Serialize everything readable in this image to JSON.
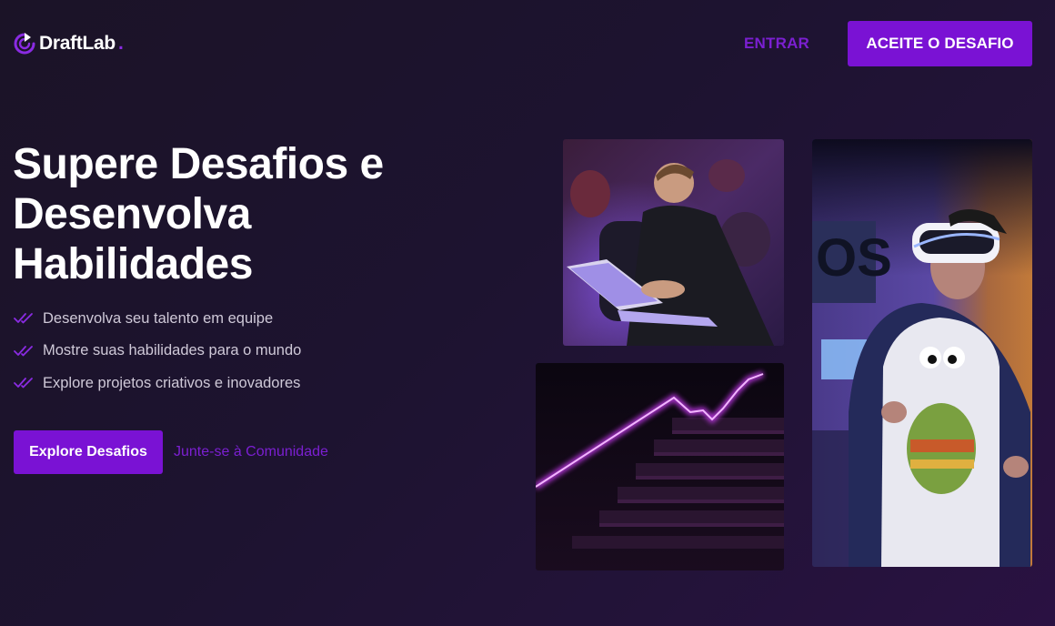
{
  "brand": {
    "name": "DraftLab",
    "dot": ".",
    "logo_icon": "play-target-icon",
    "accent_color": "#7a12d4"
  },
  "nav": {
    "login_label": "ENTRAR",
    "cta_label": "ACEITE O DESAFIO"
  },
  "hero": {
    "title": "Supere Desafios e Desenvolva Habilidades",
    "features": [
      {
        "icon": "double-check-icon",
        "label": "Desenvolva seu talento em equipe"
      },
      {
        "icon": "double-check-icon",
        "label": "Mostre suas habilidades para o mundo"
      },
      {
        "icon": "double-check-icon",
        "label": "Explore projetos criativos e inovadores"
      }
    ],
    "primary_button": "Explore Desafios",
    "secondary_link": "Junte-se à Comunidade"
  },
  "gallery": {
    "images": [
      {
        "name": "hackathon-photo"
      },
      {
        "name": "neon-stairs-photo"
      },
      {
        "name": "vr-headset-photo"
      }
    ]
  }
}
